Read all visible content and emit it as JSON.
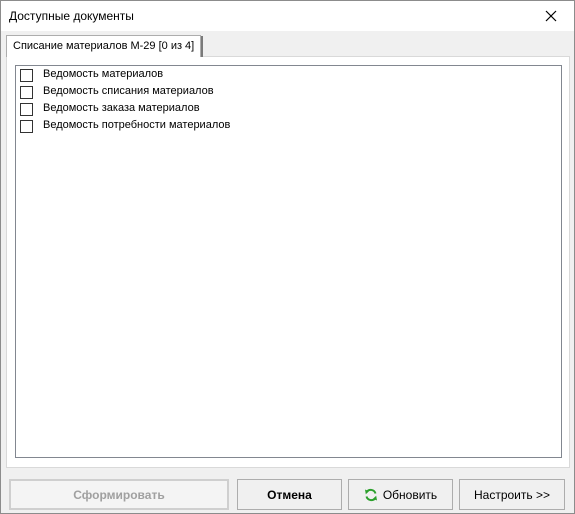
{
  "window": {
    "title": "Доступные документы"
  },
  "tabs": [
    {
      "label": "Списание материалов М-29 [0 из 4]"
    }
  ],
  "documents": [
    {
      "label": "Ведомость материалов",
      "checked": false
    },
    {
      "label": "Ведомость списания материалов",
      "checked": false
    },
    {
      "label": "Ведомость заказа материалов",
      "checked": false
    },
    {
      "label": "Ведомость потребности материалов",
      "checked": false
    }
  ],
  "buttons": {
    "form_label": "Сформировать",
    "cancel_label": "Отмена",
    "refresh_label": "Обновить",
    "setup_label": "Настроить >>"
  },
  "icons": {
    "close": "close-icon",
    "refresh": "refresh-icon"
  },
  "colors": {
    "refresh_icon": "#2ca02c",
    "disabled_text": "#a0a0a0"
  }
}
